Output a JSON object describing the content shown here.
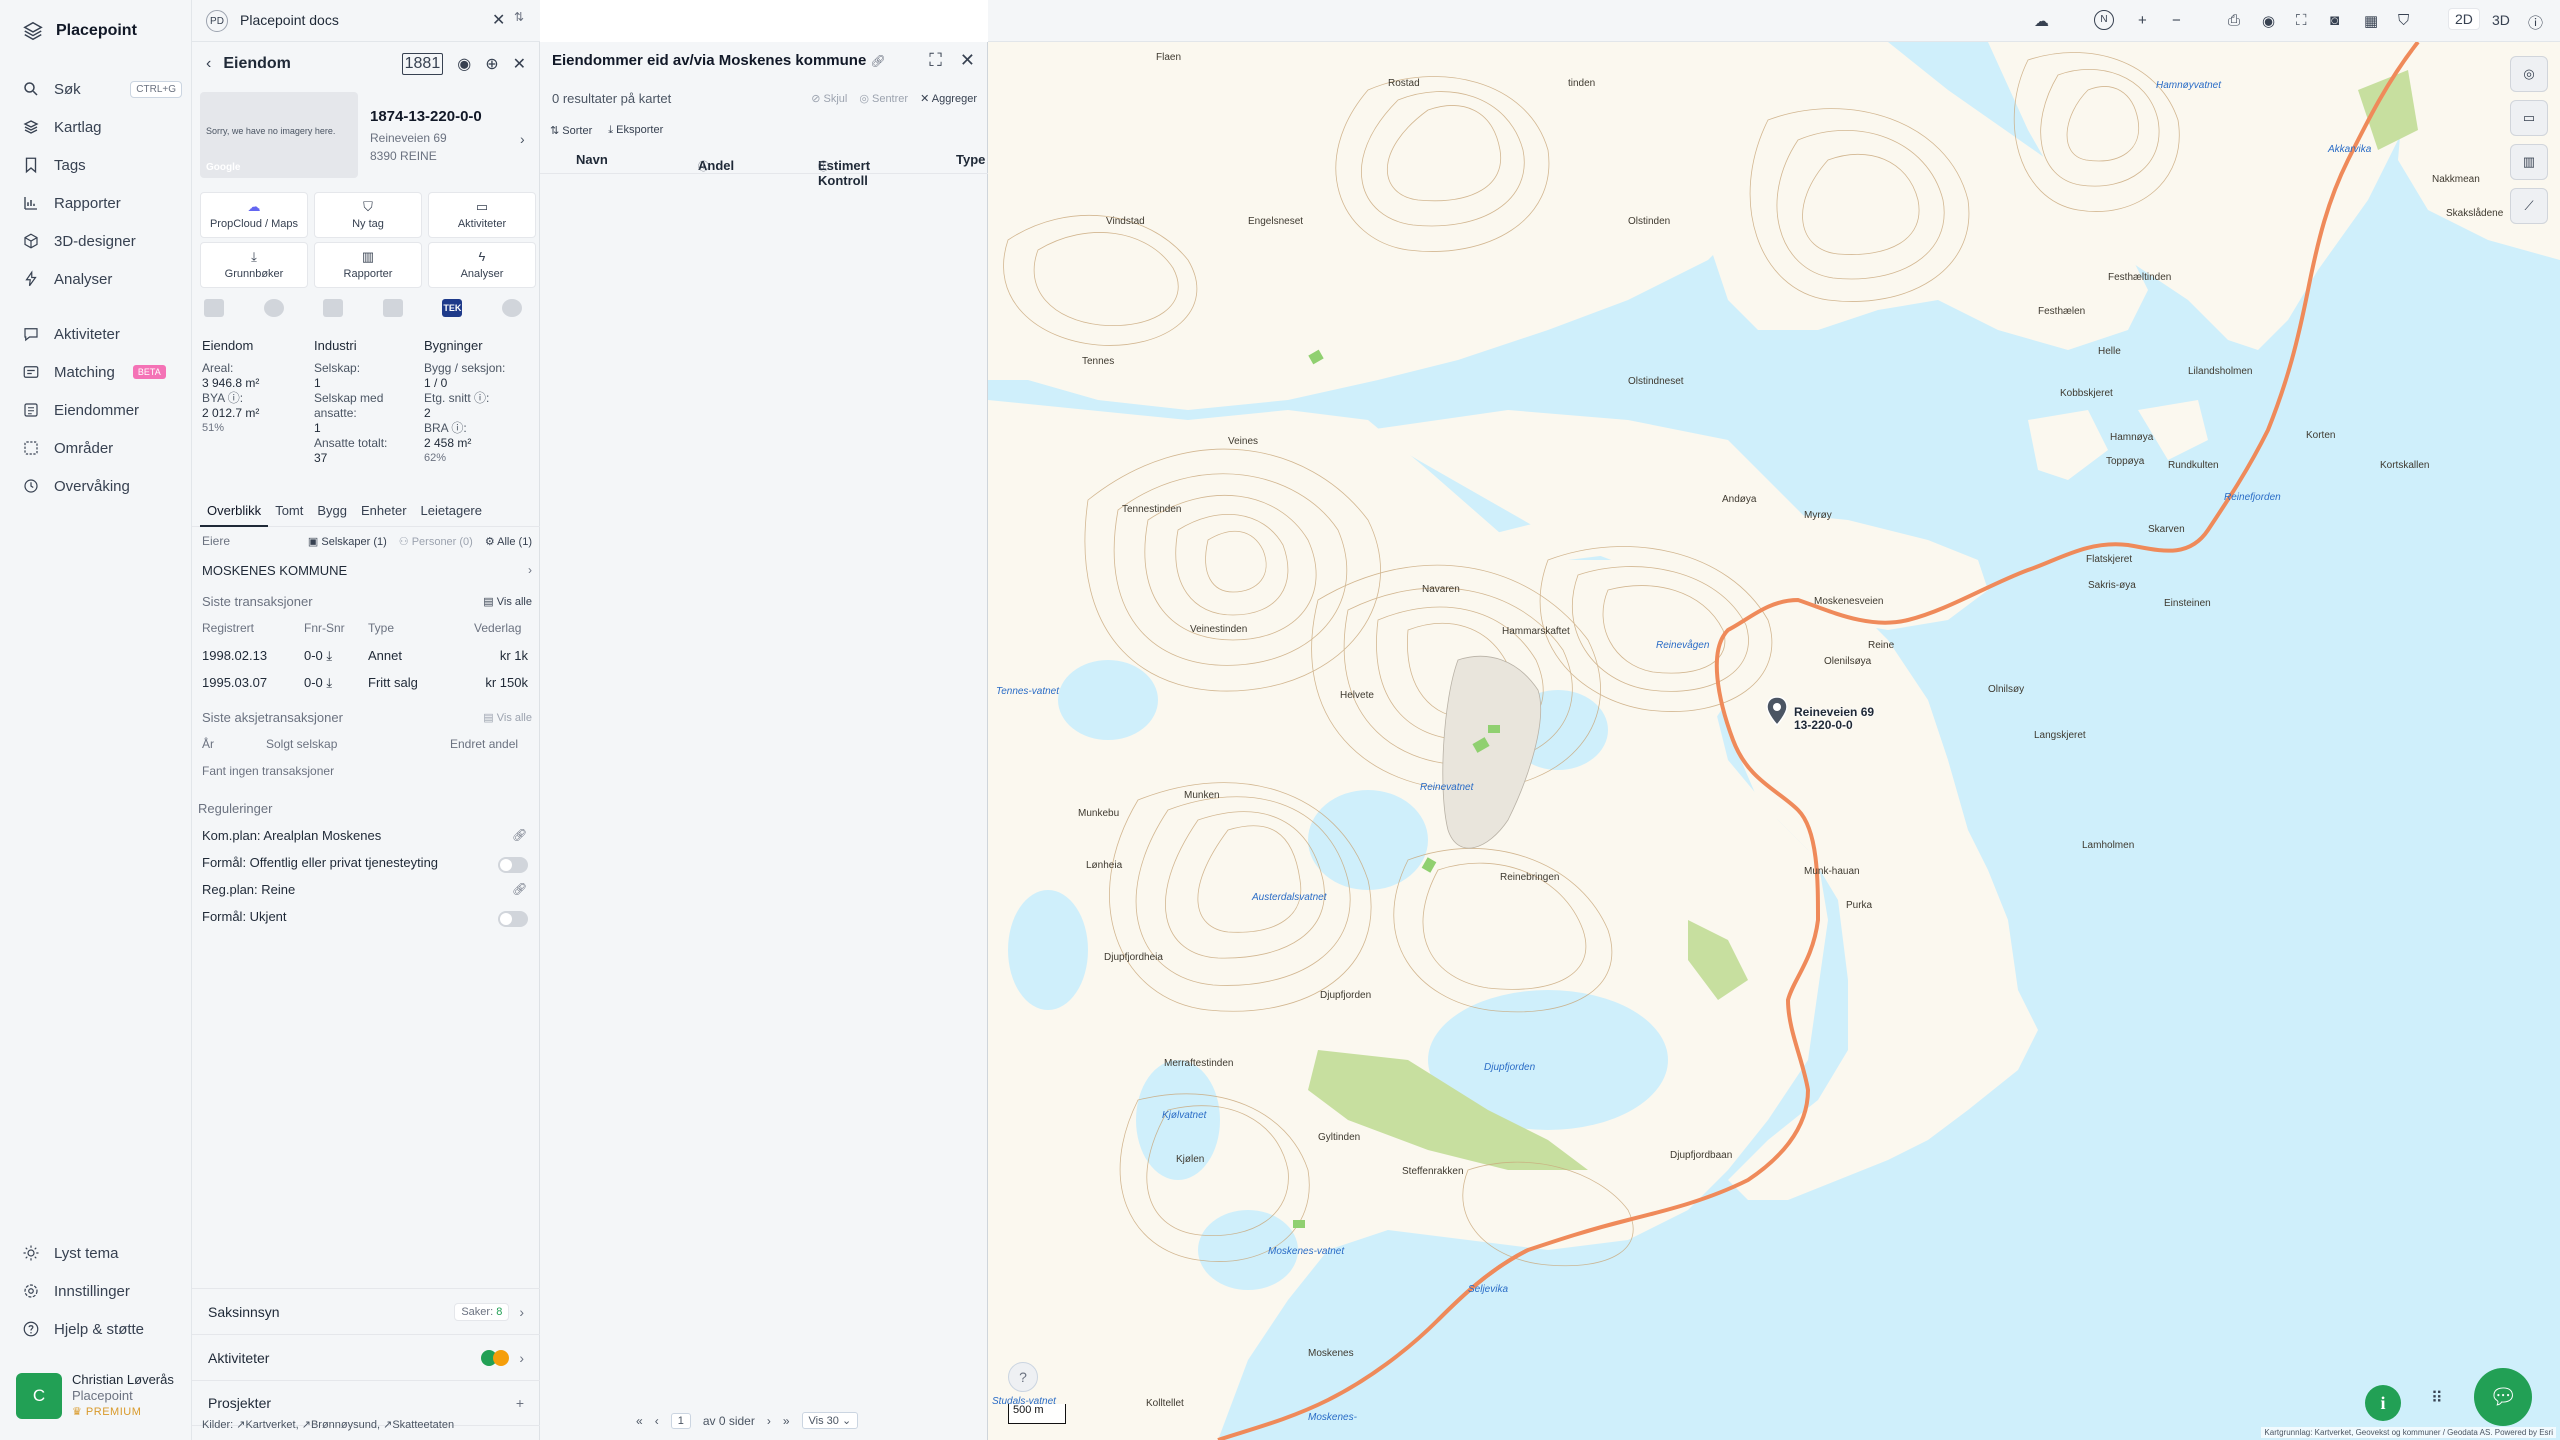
{
  "app": {
    "brand": "Placepoint",
    "nav": [
      {
        "label": "Søk",
        "shortcut": "CTRL+G",
        "icon": "search-icon"
      },
      {
        "label": "Kartlag",
        "icon": "layers-icon"
      },
      {
        "label": "Tags",
        "icon": "bookmark-icon"
      },
      {
        "label": "Rapporter",
        "icon": "chart-icon"
      },
      {
        "label": "3D-designer",
        "icon": "cube-icon"
      },
      {
        "label": "Analyser",
        "icon": "bolt-icon"
      },
      {
        "label": "Aktiviteter",
        "icon": "chat-icon"
      },
      {
        "label": "Matching",
        "badge": "BETA",
        "icon": "matching-icon"
      },
      {
        "label": "Eiendommer",
        "icon": "list-icon"
      },
      {
        "label": "Områder",
        "icon": "area-icon"
      },
      {
        "label": "Overvåking",
        "icon": "monitor-icon"
      }
    ],
    "footer_nav": [
      {
        "label": "Lyst tema",
        "icon": "sun-icon"
      },
      {
        "label": "Innstillinger",
        "icon": "gear-icon"
      },
      {
        "label": "Hjelp & støtte",
        "icon": "help-icon"
      }
    ],
    "user": {
      "initial": "C",
      "name": "Christian Løverås",
      "org": "Placepoint",
      "plan": "PREMIUM"
    }
  },
  "workspace": {
    "badge": "PD",
    "name": "Placepoint docs"
  },
  "property": {
    "header": "Eiendom",
    "tag1881": "1881",
    "image_message": "Sorry, we have no imagery here.",
    "image_credit": "Google",
    "id": "1874-13-220-0-0",
    "address1": "Reineveien 69",
    "address2": "8390 REINE",
    "quick_actions": [
      "PropCloud / Maps",
      "Ny tag",
      "Aktiviteter",
      "Grunnbøker",
      "Rapporter",
      "Analyser"
    ],
    "sources_badge": "TEK",
    "stats": {
      "eiendom": {
        "title": "Eiendom",
        "areal_label": "Areal:",
        "areal": "3 946.8 m²",
        "bya_label": "BYA ⓘ:",
        "bya": "2 012.7 m²",
        "bya_pct": "51%"
      },
      "industri": {
        "title": "Industri",
        "selskap_label": "Selskap:",
        "selskap": "1",
        "ansatte_label": "Selskap med ansatte:",
        "ansatte": "1",
        "totalt_label": "Ansatte totalt:",
        "totalt": "37"
      },
      "bygninger": {
        "title": "Bygninger",
        "bygg_label": "Bygg / seksjon:",
        "bygg": "1 / 0",
        "etg_label": "Etg. snitt ⓘ:",
        "etg": "2",
        "bra_label": "BRA ⓘ:",
        "bra": "2 458 m²",
        "bra_pct": "62%"
      }
    },
    "tabs": [
      "Overblikk",
      "Tomt",
      "Bygg",
      "Enheter",
      "Leietagere"
    ],
    "owners": {
      "label": "Eiere",
      "selskaper": "Selskaper (1)",
      "personer": "Personer (0)",
      "alle": "Alle (1)",
      "owner": "MOSKENES KOMMUNE"
    },
    "transactions": {
      "title": "Siste transaksjoner",
      "vis_alle": "Vis alle",
      "headers": [
        "Registrert",
        "Fnr-Snr",
        "Type",
        "Vederlag"
      ],
      "rows": [
        [
          "1998.02.13",
          "0-0",
          "Annet",
          "kr 1k"
        ],
        [
          "1995.03.07",
          "0-0",
          "Fritt salg",
          "kr 150k"
        ]
      ]
    },
    "share_tx": {
      "title": "Siste aksjetransaksjoner",
      "vis_alle": "Vis alle",
      "headers": [
        "År",
        "Solgt selskap",
        "Endret andel"
      ],
      "empty": "Fant ingen transaksjoner"
    },
    "regulations": {
      "title": "Reguleringer",
      "items": [
        "Kom.plan: Arealplan Moskenes",
        "Formål: Offentlig eller privat tjenesteyting",
        "Reg.plan: Reine",
        "Formål: Ukjent"
      ]
    },
    "accordions": {
      "saksinnsyn": "Saksinnsyn",
      "saker_label": "Saker:",
      "saker": "8",
      "aktiviteter": "Aktiviteter",
      "prosjekter": "Prosjekter"
    },
    "sources": {
      "label": "Kilder:",
      "items": [
        "Kartverket",
        "Brønnøysund",
        "Skatteetaten"
      ]
    }
  },
  "list": {
    "title": "Eiendommer eid av/via Moskenes kommune",
    "summary": "0 resultater på kartet",
    "skjul": "Skjul",
    "sentrer": "Sentrer",
    "aggreger": "Aggreger",
    "sorter": "Sorter",
    "eksporter": "Eksporter",
    "columns": [
      "Navn",
      "Andel",
      "Estimert Kontroll",
      "Type"
    ],
    "pager": {
      "page": "1",
      "of_label": "av 0 sider",
      "per_page": "Vis 30"
    }
  },
  "map": {
    "mode_2d": "2D",
    "mode_3d": "3D",
    "scale": "500 m",
    "attribution": "Kartgrunnlag: Kartverket, Geovekst og kommuner / Geodata AS. Powered by Esri",
    "marker_label": "Reineveien 69",
    "marker_id": "13-220-0-0",
    "labels": [
      {
        "text": "Rostad",
        "water": false
      },
      {
        "text": "Flaen",
        "water": false
      },
      {
        "text": "tinden",
        "water": false
      },
      {
        "text": "Engelsneset",
        "water": false
      },
      {
        "text": "Vindstad",
        "water": false
      },
      {
        "text": "Olstinden",
        "water": false
      },
      {
        "text": "Festhælen",
        "water": false
      },
      {
        "text": "Festhæltinden",
        "water": false
      },
      {
        "text": "Hamnøyvatnet",
        "water": true
      },
      {
        "text": "Akkarvika",
        "water": true
      },
      {
        "text": "Nakkmean",
        "water": false
      },
      {
        "text": "Skakslådene",
        "water": false
      },
      {
        "text": "Helle",
        "water": false
      },
      {
        "text": "Lilandsholmen",
        "water": false
      },
      {
        "text": "Kobbskjeret",
        "water": false
      },
      {
        "text": "Olstindneset",
        "water": false
      },
      {
        "text": "Tennes",
        "water": false
      },
      {
        "text": "Veines",
        "water": false
      },
      {
        "text": "Hamnøya",
        "water": false
      },
      {
        "text": "Toppøya",
        "water": false
      },
      {
        "text": "Korten",
        "water": false
      },
      {
        "text": "Kortskallen",
        "water": false
      },
      {
        "text": "Rundkulten",
        "water": false
      },
      {
        "text": "Reinefjorden",
        "water": true
      },
      {
        "text": "Andøya",
        "water": false
      },
      {
        "text": "Myrøy",
        "water": false
      },
      {
        "text": "Tennestinden",
        "water": false
      },
      {
        "text": "Skarven",
        "water": false
      },
      {
        "text": "Flatskjeret",
        "water": false
      },
      {
        "text": "Navaren",
        "water": false
      },
      {
        "text": "Moskenesveien",
        "water": false
      },
      {
        "text": "Sakris-øya",
        "water": false
      },
      {
        "text": "Einsteinen",
        "water": false
      },
      {
        "text": "Veinestinden",
        "water": false
      },
      {
        "text": "Hammarskaftet",
        "water": false
      },
      {
        "text": "Reinevågen",
        "water": true
      },
      {
        "text": "Reine",
        "water": false
      },
      {
        "text": "Olenilsøya",
        "water": false
      },
      {
        "text": "Olnilsøy",
        "water": false
      },
      {
        "text": "Tennes-vatnet",
        "water": true
      },
      {
        "text": "Helvete",
        "water": false
      },
      {
        "text": "Langskjeret",
        "water": false
      },
      {
        "text": "Reinevatnet",
        "water": true
      },
      {
        "text": "Munkebu",
        "water": false
      },
      {
        "text": "Munken",
        "water": false
      },
      {
        "text": "Lamholmen",
        "water": false
      },
      {
        "text": "Reinebringen",
        "water": false
      },
      {
        "text": "Lønheia",
        "water": false
      },
      {
        "text": "Austerdalsvatnet",
        "water": true
      },
      {
        "text": "Munk-hauan",
        "water": false
      },
      {
        "text": "Purka",
        "water": false
      },
      {
        "text": "Djupfjordheia",
        "water": false
      },
      {
        "text": "Djupfjorden",
        "water": false
      },
      {
        "text": "Djupfjorden",
        "water": true
      },
      {
        "text": "Merraftestinden",
        "water": false
      },
      {
        "text": "Kjølvatnet",
        "water": true
      },
      {
        "text": "Kjølen",
        "water": false
      },
      {
        "text": "Gyltinden",
        "water": false
      },
      {
        "text": "Steffenrakken",
        "water": false
      },
      {
        "text": "Djupfjordbaan",
        "water": false
      },
      {
        "text": "Moskenes-vatnet",
        "water": true
      },
      {
        "text": "Seljevika",
        "water": true
      },
      {
        "text": "Moskenes",
        "water": false
      },
      {
        "text": "Kolltellet",
        "water": false
      },
      {
        "text": "Studals-vatnet",
        "water": true
      },
      {
        "text": "Moskenes-",
        "water": true
      }
    ]
  },
  "colors": {
    "accent": "#22a055",
    "water": "#cfeffb",
    "land": "#fbf8ef",
    "road": "#ef8a5a",
    "beta": "#f472b6"
  }
}
